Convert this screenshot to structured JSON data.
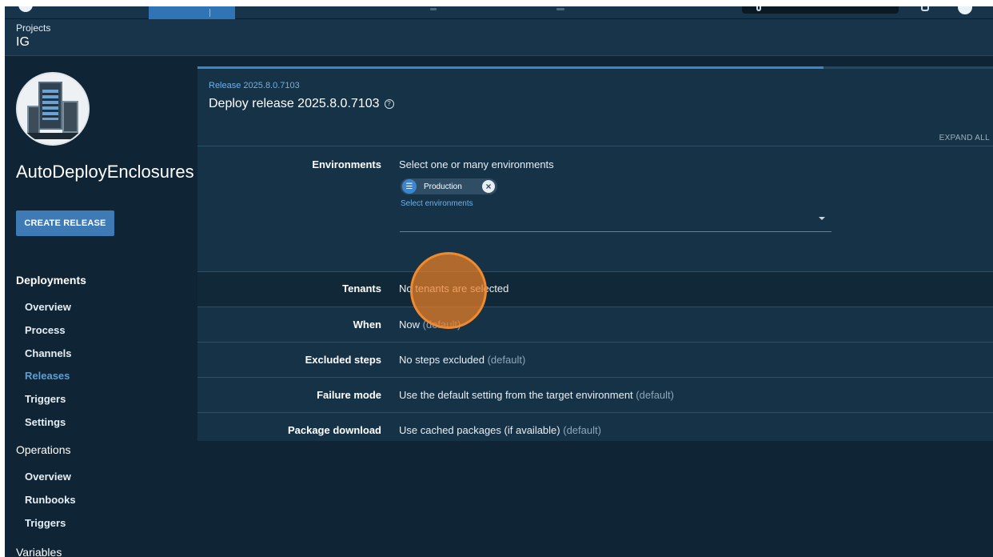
{
  "breadcrumb": {
    "label": "Projects",
    "title": "IG"
  },
  "sidebar": {
    "project_name": "AutoDeployEnclosures",
    "create_release": "CREATE RELEASE",
    "deployments_heading": "Deployments",
    "deployment_items": [
      {
        "label": "Overview",
        "active": false
      },
      {
        "label": "Process",
        "active": false
      },
      {
        "label": "Channels",
        "active": false
      },
      {
        "label": "Releases",
        "active": true
      },
      {
        "label": "Triggers",
        "active": false
      },
      {
        "label": "Settings",
        "active": false
      }
    ],
    "operations_heading": "Operations",
    "operation_items": [
      {
        "label": "Overview"
      },
      {
        "label": "Runbooks"
      },
      {
        "label": "Triggers"
      }
    ],
    "variables_heading": "Variables"
  },
  "panel": {
    "release_link": "Release 2025.8.0.7103",
    "title": "Deploy release 2025.8.0.7103",
    "help_glyph": "?",
    "expand_all": "EXPAND ALL",
    "environments": {
      "label": "Environments",
      "prompt": "Select one or many environments",
      "chip_label": "Production",
      "chip_icon": "environment-icon",
      "select_hint": "Select environments"
    },
    "tenants": {
      "label": "Tenants",
      "value": "No tenants are selected"
    },
    "when": {
      "label": "When",
      "value": "Now",
      "default": "(default)"
    },
    "excluded_steps": {
      "label": "Excluded steps",
      "value": "No steps excluded",
      "default": "(default)"
    },
    "failure_mode": {
      "label": "Failure mode",
      "value": "Use the default setting from the target environment",
      "default": "(default)"
    },
    "package_download": {
      "label": "Package download",
      "value": "Use cached packages (if available)",
      "default": "(default)"
    }
  },
  "colors": {
    "accent": "#3c85c8",
    "background": "#0f2535",
    "panel": "#163247",
    "click_marker": "#f08a2e"
  }
}
